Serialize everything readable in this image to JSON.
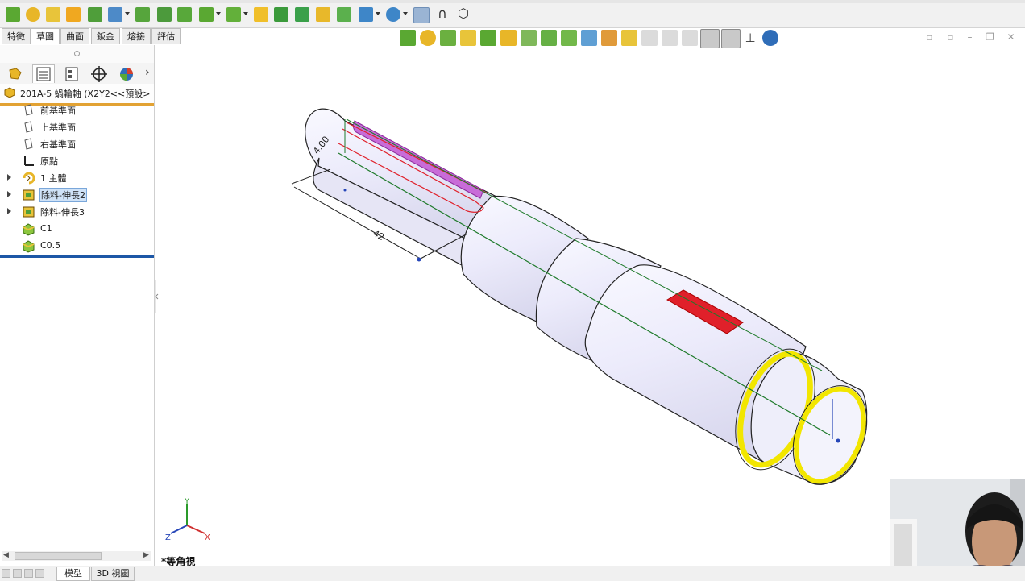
{
  "command_tabs": [
    {
      "label": "特徵",
      "active": false
    },
    {
      "label": "草圖",
      "active": true
    },
    {
      "label": "曲面",
      "active": false
    },
    {
      "label": "鈑金",
      "active": false
    },
    {
      "label": "熔接",
      "active": false
    },
    {
      "label": "評估",
      "active": false
    }
  ],
  "feature_tree": {
    "part_name": "201A-5 蝸輪軸  (X2Y2<<預設>",
    "items": [
      {
        "label": "前基準面",
        "icon": "plane-icon",
        "expandable": false,
        "selected": false
      },
      {
        "label": "上基準面",
        "icon": "plane-icon",
        "expandable": false,
        "selected": false
      },
      {
        "label": "右基準面",
        "icon": "plane-icon",
        "expandable": false,
        "selected": false
      },
      {
        "label": "原點",
        "icon": "origin-icon",
        "expandable": false,
        "selected": false
      },
      {
        "label": "1 主體",
        "icon": "revolve-icon",
        "expandable": true,
        "selected": false
      },
      {
        "label": "除料-伸長2",
        "icon": "cut-extrude-icon",
        "expandable": true,
        "selected": true
      },
      {
        "label": "除料-伸長3",
        "icon": "cut-extrude-icon",
        "expandable": true,
        "selected": false
      },
      {
        "label": "C1",
        "icon": "chamfer-icon",
        "expandable": false,
        "selected": false
      },
      {
        "label": "C0.5",
        "icon": "chamfer-icon",
        "expandable": false,
        "selected": false
      }
    ]
  },
  "bottom_tabs": [
    {
      "label": "模型",
      "active": true
    },
    {
      "label": "3D 視圖",
      "active": false
    }
  ],
  "viewport": {
    "view_name": "*等角視",
    "dimension_width": "4.00",
    "dimension_length": "42",
    "triad": {
      "x": "X",
      "y": "Y",
      "z": "Z"
    }
  },
  "colors": {
    "accent_orange": "#e2a233",
    "tree_end": "#1d57a6",
    "keyway_fill": "#c86cd8",
    "selected_edge": "#e0202a",
    "chamfer_yellow": "#f2e600",
    "sketch_green": "#1e7a2a"
  }
}
